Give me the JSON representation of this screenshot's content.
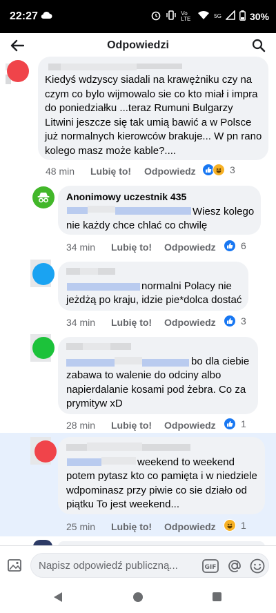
{
  "status_bar": {
    "time": "22:27",
    "network_type": "Vo LTE",
    "signal_label": "5G",
    "battery": "30%"
  },
  "header": {
    "title": "Odpowiedzi",
    "back_icon": "arrow-left-icon",
    "search_icon": "search-icon"
  },
  "colors": {
    "accent": "#1877f2",
    "bubble": "#f0f2f5",
    "muted": "#65676b",
    "highlight": "#e7f0fd"
  },
  "comments": [
    {
      "author": "",
      "avatar_color": "#f0444a",
      "lines": [
        "Kiedyś wdzyscy siadali na krawężniku czy na",
        "czym co bylo wijmowalo sie co kto miał i impra",
        "do poniedziałku ...teraz Rumuni Bulgarzy",
        "Litwini jeszcze się tak umią bawić a w Polsce",
        "już normalnych kierowców brakuje... W pn rano",
        "kolego masz może kable?...."
      ],
      "time": "48 min",
      "like_label": "Lubię to!",
      "reply_label": "Odpowiedz",
      "reactions": [
        "like",
        "haha"
      ],
      "reaction_count": "3"
    },
    {
      "author": "Anonimowy uczestnik 435",
      "avatar_color": "#42b72a",
      "lines": [
        "Wiesz kolego",
        "nie każdy chce chlać co chwilę"
      ],
      "time": "34 min",
      "like_label": "Lubię to!",
      "reply_label": "Odpowiedz",
      "reactions": [
        "like"
      ],
      "reaction_count": "6"
    },
    {
      "author": "",
      "avatar_color": "#1aa3f2",
      "lines": [
        "normalni Polacy nie",
        "jeżdżą po kraju, idzie pie*dolca dostać"
      ],
      "time": "34 min",
      "like_label": "Lubię to!",
      "reply_label": "Odpowiedz",
      "reactions": [
        "like"
      ],
      "reaction_count": "3"
    },
    {
      "author": "",
      "avatar_color": "#1cc23a",
      "lines": [
        "bo dla ciebie",
        "zabawa to walenie do odciny albo",
        "napierdalanie kosami pod żebra. Co za",
        "prymityw xD"
      ],
      "time": "28 min",
      "like_label": "Lubię to!",
      "reply_label": "Odpowiedz",
      "reactions": [
        "like"
      ],
      "reaction_count": "1"
    },
    {
      "author": "",
      "avatar_color": "#f0444a",
      "lines": [
        "weekend to weekend",
        "potem pytasz kto co pamięta i w niedziele",
        "wdpominasz przy piwie co sie działo od",
        "piątku To jest weekend..."
      ],
      "time": "25 min",
      "like_label": "Lubię to!",
      "reply_label": "Odpowiedz",
      "reactions": [
        "haha"
      ],
      "reaction_count": "1"
    }
  ],
  "composer": {
    "placeholder": "Napisz odpowiedź publiczną...",
    "gif_label": "GIF"
  }
}
